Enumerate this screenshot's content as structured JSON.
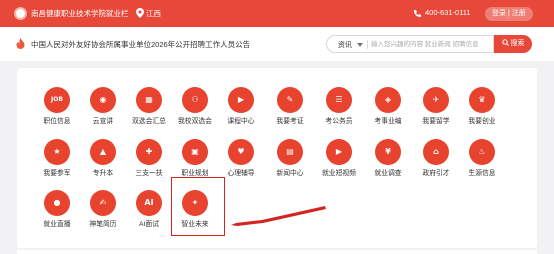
{
  "header": {
    "school_name": "南昌健康职业技术学院就业栏",
    "location": "江西",
    "phone": "400-631-0111",
    "auth_label": "登录 | 注册"
  },
  "notice": {
    "text": "中国人民对外友好协会所属事业单位2026年公开招聘工作人员公告"
  },
  "search": {
    "category": "资讯",
    "placeholder": "输入您兴趣的内容 就业新闻 招聘信息",
    "button_label": "搜索"
  },
  "services": [
    {
      "label": "职位信息",
      "icon": "job-icon",
      "glyph": "JOB"
    },
    {
      "label": "云宣讲",
      "icon": "cloud-presentation-icon",
      "glyph": "◉"
    },
    {
      "label": "双选会汇总",
      "icon": "grid-icon",
      "glyph": "▦"
    },
    {
      "label": "我校双选会",
      "icon": "people-icon",
      "glyph": "⚇"
    },
    {
      "label": "课程中心",
      "icon": "course-icon",
      "glyph": "▶"
    },
    {
      "label": "我要考证",
      "icon": "certificate-icon",
      "glyph": "✎"
    },
    {
      "label": "考公务员",
      "icon": "civil-exam-icon",
      "glyph": "☰"
    },
    {
      "label": "考事业编",
      "icon": "career-exam-icon",
      "glyph": "◈"
    },
    {
      "label": "我要留学",
      "icon": "study-abroad-icon",
      "glyph": "✈"
    },
    {
      "label": "我要创业",
      "icon": "startup-icon",
      "glyph": "♛"
    },
    {
      "label": "我要参军",
      "icon": "military-icon",
      "glyph": "★"
    },
    {
      "label": "专升本",
      "icon": "graduation-cap-icon",
      "glyph": "▲"
    },
    {
      "label": "三支一扶",
      "icon": "support-program-icon",
      "glyph": "✚"
    },
    {
      "label": "职业规划",
      "icon": "career-planning-icon",
      "glyph": "▣"
    },
    {
      "label": "心理辅导",
      "icon": "heart-icon",
      "glyph": "♥"
    },
    {
      "label": "新闻中心",
      "icon": "news-icon",
      "glyph": "▤"
    },
    {
      "label": "就业短视频",
      "icon": "video-icon",
      "glyph": "▶"
    },
    {
      "label": "就业调查",
      "icon": "survey-icon",
      "glyph": "¥"
    },
    {
      "label": "政府引才",
      "icon": "government-icon",
      "glyph": "⌂"
    },
    {
      "label": "生源信息",
      "icon": "flame-icon",
      "glyph": "♨"
    },
    {
      "label": "就业直播",
      "icon": "live-broadcast-icon",
      "glyph": "●"
    },
    {
      "label": "神笔简历",
      "icon": "resume-icon",
      "glyph": "✍"
    },
    {
      "label": "AI面试",
      "icon": "ai-interview-icon",
      "glyph": "AI"
    },
    {
      "label": "智业未来",
      "icon": "smart-future-icon",
      "glyph": "✦"
    }
  ],
  "colors": {
    "brand": "#e8483a",
    "icon_bg": "#e8432e",
    "highlight": "#d42323"
  }
}
